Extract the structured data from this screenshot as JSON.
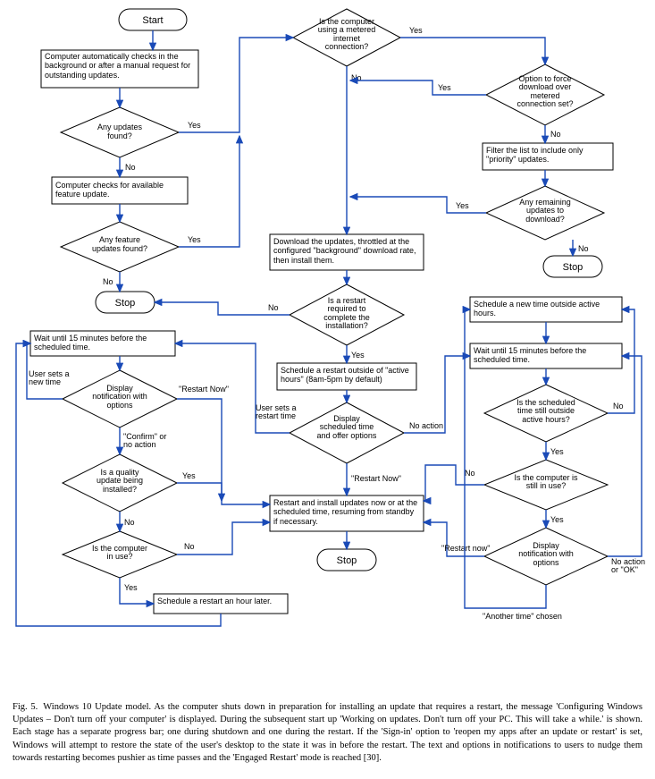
{
  "diagram_title": "Windows 10 Update model flowchart",
  "arrow_color": "#1a4ab7",
  "nodes": {
    "start": "Start",
    "check": "Computer automatically checks in the background or after a manual request for outstanding updates.",
    "anyUpdates": "Any updates found?",
    "featureCheck": "Computer checks for available feature update.",
    "anyFeature": "Any feature updates found?",
    "stop1": "Stop",
    "metered": "Is the computer using a metered internet connection?",
    "forceOption": "Option to force download over metered connection set?",
    "filter": "Filter the list to include only \"priority\" updates.",
    "anyRemaining": "Any remaining updates to download?",
    "stop2": "Stop",
    "download": "Download the updates, throttled at the configured \"background\" download rate, then install them.",
    "restartReq": "Is a restart required to complete the installation?",
    "scheduleActive": "Schedule a restart outside of \"active hours\" (8am-5pm by default)",
    "displaySched": "Display scheduled time and offer options",
    "restartInstall": "Restart and install updates now or at the scheduled time, resuming from standby if necessary.",
    "stop3": "Stop",
    "wait15L": "Wait until 15 minutes before the scheduled time.",
    "notifL": "Display notification with options",
    "quality": "Is a quality update being installed?",
    "inUseL": "Is the computer in use?",
    "scheduleHour": "Schedule a restart an hour later.",
    "scheduleNew": "Schedule a new time outside active hours.",
    "wait15R": "Wait until 15 minutes before the scheduled time.",
    "stillOutside": "Is the scheduled time still outside active hours?",
    "inUseR": "Is the computer is still in use?",
    "notifR": "Display notification with options"
  },
  "edge_labels": {
    "yes": "Yes",
    "no": "No",
    "restartNow": "\"Restart Now\"",
    "restartNowLc": "\"Restart now\"",
    "confirmOrNo": "\"Confirm\" or no action",
    "userSetsNew": "User sets a new time",
    "userSetsRestart": "User sets a restart time",
    "noAction": "No action",
    "anotherTime": "\"Another time\" chosen",
    "noActionOk": "No action or \"OK\""
  },
  "caption_prefix": "Fig. 5.",
  "caption_body": "Windows 10 Update model. As the computer shuts down in preparation for installing an update that requires a restart, the message 'Configuring Windows Updates – Don't turn off your computer' is displayed. During the subsequent start up 'Working on updates. Don't turn off your PC. This will take a while.' is shown. Each stage has a separate progress bar; one during shutdown and one during the restart. If the 'Sign-in' option to 'reopen my apps after an update or restart' is set, Windows will attempt to restore the state of the user's desktop to the state it was in before the restart. The text and options in notifications to users to nudge them towards restarting becomes pushier as time passes and the 'Engaged Restart' mode is reached [30]."
}
